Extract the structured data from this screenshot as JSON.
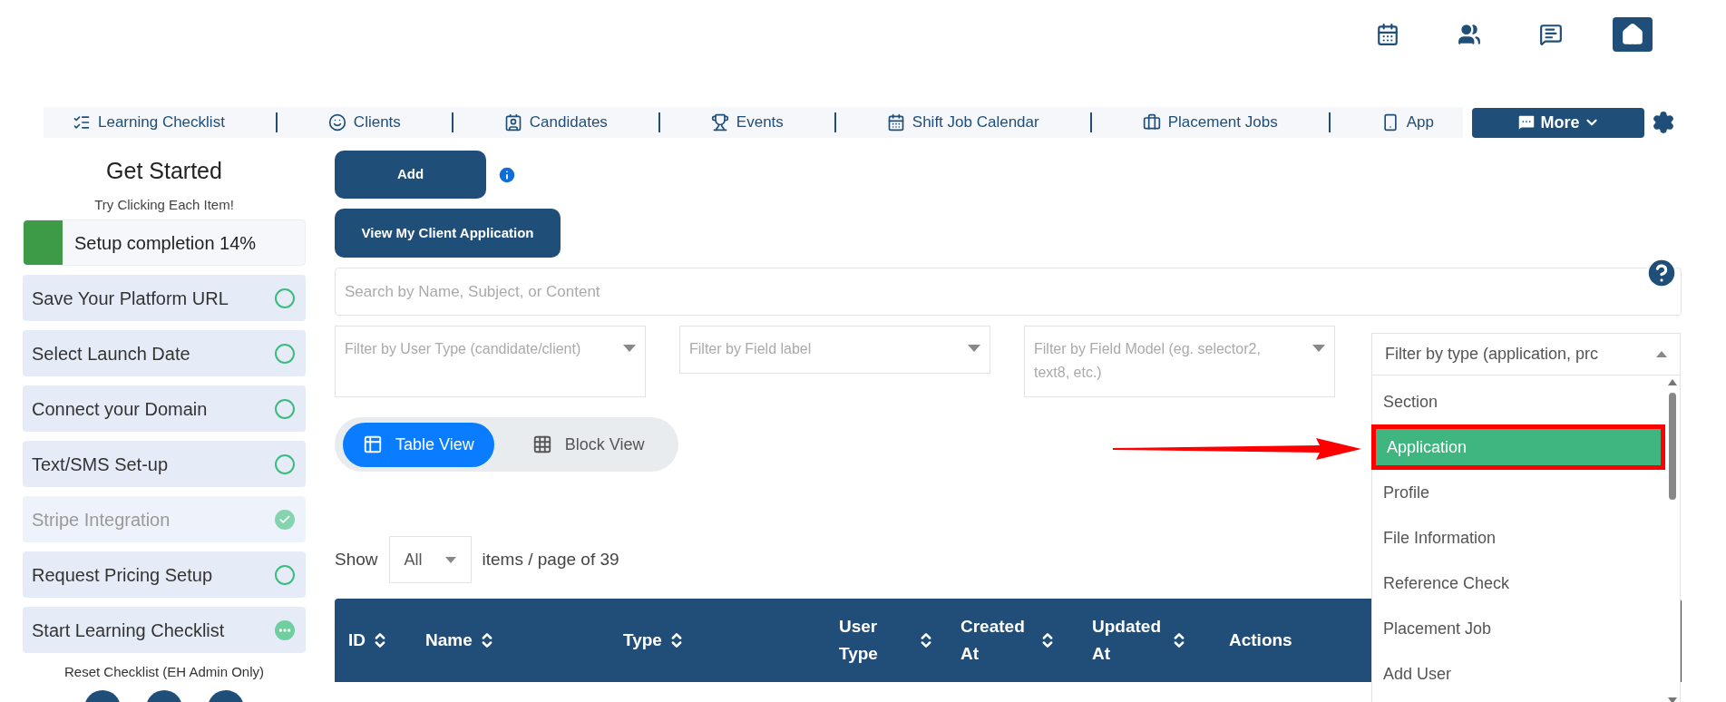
{
  "top_icons": [
    {
      "kind": "calendar",
      "selected": false
    },
    {
      "kind": "people",
      "selected": false
    },
    {
      "kind": "chat",
      "selected": false
    },
    {
      "kind": "home",
      "selected": true
    }
  ],
  "nav": {
    "items": [
      {
        "label": "Learning Checklist"
      },
      {
        "label": "Clients"
      },
      {
        "label": "Candidates"
      },
      {
        "label": "Events"
      },
      {
        "label": "Shift Job Calendar"
      },
      {
        "label": "Placement Jobs"
      },
      {
        "label": "App"
      }
    ],
    "more": "More"
  },
  "sidebar": {
    "title": "Get Started",
    "subtitle": "Try Clicking Each Item!",
    "progress": {
      "label": "Setup completion 14%",
      "level": 0.14
    },
    "items": [
      {
        "label": "Save Your Platform URL",
        "kind": "pending"
      },
      {
        "label": "Select Launch Date",
        "kind": "pending"
      },
      {
        "label": "Connect your Domain",
        "kind": "pending"
      },
      {
        "label": "Text/SMS Set-up",
        "kind": "pending"
      },
      {
        "label": "Stripe Integration",
        "kind": "done"
      },
      {
        "label": "Request Pricing Setup",
        "kind": "pending"
      },
      {
        "label": "Start Learning Checklist",
        "kind": "started"
      }
    ],
    "reset": "Reset Checklist (EH Admin Only)"
  },
  "buttons": {
    "add": "Add",
    "view_application": "View My Client Application"
  },
  "search": {
    "placeholder": "Search by Name, Subject, or Content"
  },
  "filters": [
    {
      "placeholder": "Filter by User Type (candidate/client)"
    },
    {
      "placeholder": "Filter by Field label"
    },
    {
      "placeholder": "Filter by Field Model (eg. selector2, text8, etc.)"
    }
  ],
  "type_filter": {
    "placeholder": "Filter by type (application, prc",
    "expanded": true,
    "options": [
      {
        "label": "Section",
        "selected": false
      },
      {
        "label": "Application",
        "selected": true
      },
      {
        "label": "Profile",
        "selected": false
      },
      {
        "label": "File Information",
        "selected": false
      },
      {
        "label": "Reference Check",
        "selected": false
      },
      {
        "label": "Placement Job",
        "selected": false
      },
      {
        "label": "Add User",
        "selected": false
      }
    ]
  },
  "view_toggle": [
    {
      "label": "Table View",
      "selected": true
    },
    {
      "label": "Block View",
      "selected": false
    }
  ],
  "pagination": {
    "show": "Show",
    "per_page": "All",
    "suffix": "items / page of 39"
  },
  "table": {
    "columns": [
      {
        "label": "ID",
        "sortable": true
      },
      {
        "label": "Name",
        "sortable": true
      },
      {
        "label": "Type",
        "sortable": true
      },
      {
        "label": "User Type",
        "sortable": true
      },
      {
        "label": "Created At",
        "sortable": true
      },
      {
        "label": "Updated At",
        "sortable": true
      },
      {
        "label": "Actions",
        "sortable": false
      }
    ]
  }
}
